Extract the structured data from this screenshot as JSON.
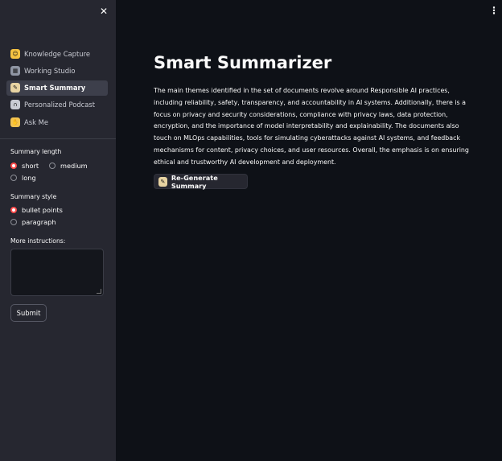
{
  "sidebar": {
    "nav": [
      {
        "label": "Knowledge Capture",
        "icon": "hugging-face-icon",
        "icon_bg": "#f5c242",
        "icon_glyph": "☺"
      },
      {
        "label": "Working Studio",
        "icon": "film-frames-icon",
        "icon_bg": "#8f95a3",
        "icon_glyph": "▦"
      },
      {
        "label": "Smart Summary",
        "icon": "memo-icon",
        "icon_bg": "#e7d3a2",
        "icon_glyph": "✎",
        "active": true
      },
      {
        "label": "Personalized Podcast",
        "icon": "headphones-icon",
        "icon_bg": "#c9cbd3",
        "icon_glyph": "∩"
      },
      {
        "label": "Ask Me",
        "icon": "raised-hand-icon",
        "icon_bg": "#f3c34f",
        "icon_glyph": "✋"
      }
    ],
    "summary_length": {
      "label": "Summary length",
      "options": [
        "short",
        "medium",
        "long"
      ],
      "selected": "short"
    },
    "summary_style": {
      "label": "Summary style",
      "options": [
        "bullet points",
        "paragraph"
      ],
      "selected": "bullet points"
    },
    "instructions": {
      "label": "More instructions:",
      "value": ""
    },
    "submit_label": "Submit"
  },
  "main": {
    "title": "Smart Summarizer",
    "summary": "The main themes identified in the set of documents revolve around Responsible AI practices, including reliability, safety, transparency, and accountability in AI systems. Additionally, there is a focus on privacy and security considerations, compliance with privacy laws, data protection, encryption, and the importance of model interpretability and explainability. The documents also touch on MLOps capabilities, tools for simulating cyberattacks against AI systems, and feedback mechanisms for content, privacy choices, and user resources. Overall, the emphasis is on ensuring ethical and trustworthy AI development and deployment.",
    "regenerate_label": "Re-Generate Summary",
    "regenerate_icon": "memo-icon"
  },
  "colors": {
    "accent": "#ff4b4b",
    "sidebar_bg": "#262730",
    "main_bg": "#0e1117"
  }
}
